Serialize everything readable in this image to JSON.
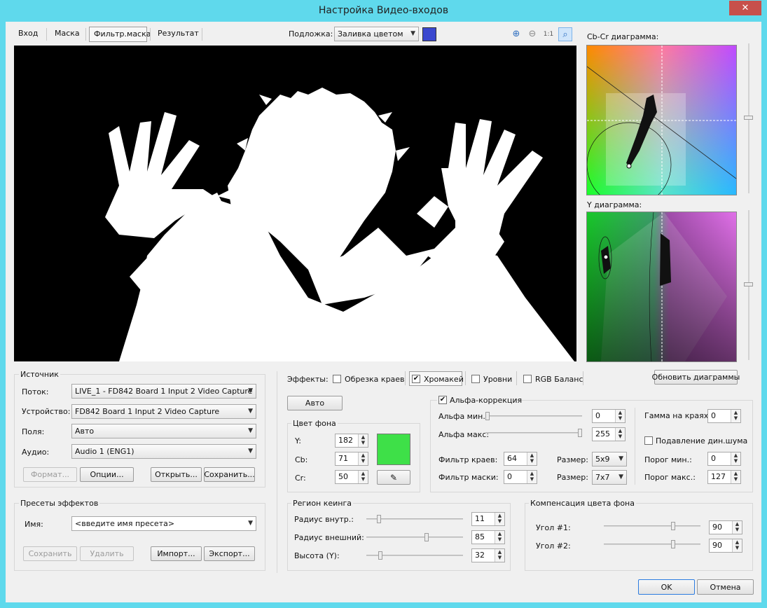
{
  "window": {
    "title": "Настройка Видео-входов",
    "close": "✕"
  },
  "tabs": [
    {
      "label": "Вход"
    },
    {
      "label": "Маска"
    },
    {
      "label": "Фильтр.маска"
    },
    {
      "label": "Результат"
    }
  ],
  "background": {
    "label": "Подложка:",
    "value": "Заливка цветом",
    "swatch": "#3b48cf"
  },
  "zoom": [
    "zoom-in-icon",
    "zoom-out-icon",
    "zoom-100-icon",
    "zoom-fit-icon"
  ],
  "cbcr": {
    "title": "Cb-Cr диаграмма:"
  },
  "ydiag": {
    "title": "Y диаграмма:"
  },
  "source": {
    "title": "Источник",
    "stream_label": "Поток:",
    "stream_value": "LIVE_1 - FD842 Board 1 Input 2 Video Capture",
    "device_label": "Устройство:",
    "device_value": "FD842 Board 1 Input 2 Video Capture",
    "fields_label": "Поля:",
    "fields_value": "Авто",
    "audio_label": "Аудио:",
    "audio_value": "Audio 1 (ENG1)",
    "format": "Формат...",
    "options": "Опции...",
    "open": "Открыть...",
    "save": "Сохранить..."
  },
  "presets": {
    "title": "Пресеты эффектов",
    "name_label": "Имя:",
    "name_value": "<введите имя пресета>",
    "save": "Сохранить",
    "delete": "Удалить",
    "import": "Импорт...",
    "export": "Экспорт..."
  },
  "effects": {
    "label": "Эффекты:",
    "items": [
      {
        "label": "Обрезка краев",
        "checked": ""
      },
      {
        "label": "Хромакей",
        "checked": "✔"
      },
      {
        "label": "Уровни",
        "checked": ""
      },
      {
        "label": "RGB Баланс",
        "checked": ""
      }
    ],
    "refresh": "Обновить диаграммы"
  },
  "auto": "Авто",
  "bgcolor": {
    "title": "Цвет фона",
    "y_label": "Y:",
    "y": "182",
    "cb_label": "Cb:",
    "cb": "71",
    "cr_label": "Cr:",
    "cr": "50",
    "swatch": "#3ee048"
  },
  "alpha": {
    "title": "Альфа-коррекция",
    "checked": "✔",
    "min_label": "Альфа мин.:",
    "min": "0",
    "min_level": 0,
    "max_label": "Альфа макс:",
    "max": "255",
    "max_level": 1,
    "edge_label": "Фильтр краев:",
    "edge": "64",
    "size1_label": "Размер:",
    "size1": "5x9",
    "mask_label": "Фильтр маски:",
    "mask": "0",
    "size2_label": "Размер:",
    "size2": "7x7",
    "gamma_label": "Гамма на краях:",
    "gamma": "0",
    "noise_label": "Подавление дин.шума",
    "noise_checked": "",
    "thrmin_label": "Порог мин.:",
    "thrmin": "0",
    "thrmax_label": "Порог макс.:",
    "thrmax": "127"
  },
  "region": {
    "title": "Регион кеинга",
    "inner_label": "Радиус внутр.:",
    "inner": "11",
    "inner_level": 0.11,
    "outer_label": "Радиус внешний:",
    "outer": "85",
    "outer_level": 0.63,
    "height_label": "Высота (Y):",
    "height": "32",
    "height_level": 0.13
  },
  "comp": {
    "title": "Компенсация цвета фона",
    "a1_label": "Угол #1:",
    "a1": "90",
    "a1_level": 0.73,
    "a2_label": "Угол #2:",
    "a2": "90",
    "a2_level": 0.73
  },
  "dialog": {
    "ok": "OK",
    "cancel": "Отмена"
  }
}
